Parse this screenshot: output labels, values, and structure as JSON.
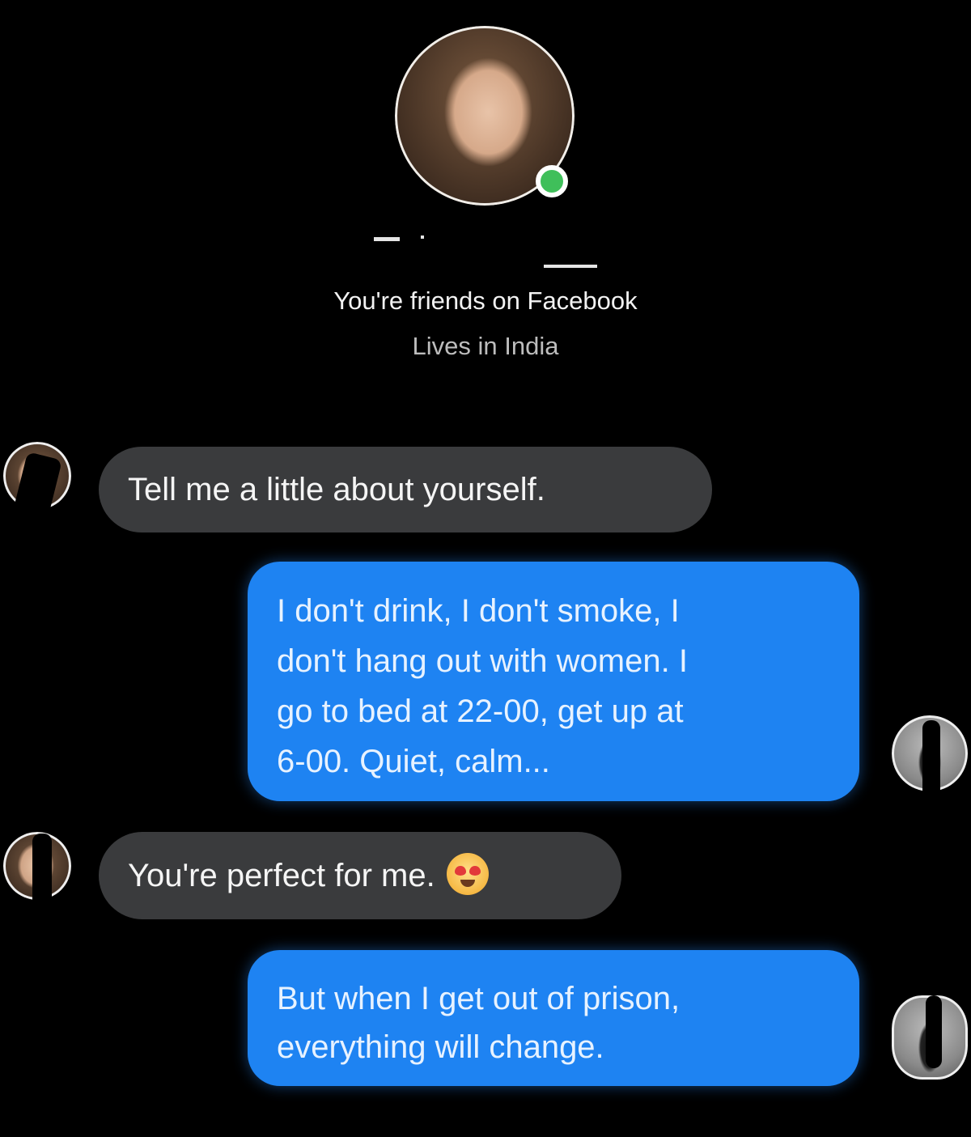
{
  "header": {
    "friends_text": "You're friends on Facebook",
    "location_text": "Lives in India",
    "online_status_color": "#3fbf5a"
  },
  "messages": [
    {
      "sender": "other",
      "text": "Tell me a little about yourself."
    },
    {
      "sender": "me",
      "lines": [
        "I don't drink, I don't smoke, I",
        "don't hang out with women. I",
        "go to bed at 22-00, get up at",
        "6-00. Quiet, calm..."
      ]
    },
    {
      "sender": "other",
      "text": "You're perfect for me.",
      "emoji": "heart-eyes-emoji"
    },
    {
      "sender": "me",
      "lines": [
        "But when I get out of prison,",
        "everything will change."
      ]
    }
  ],
  "colors": {
    "incoming_bubble": "#3a3b3d",
    "outgoing_bubble": "#1e83f2",
    "background": "#000000"
  }
}
